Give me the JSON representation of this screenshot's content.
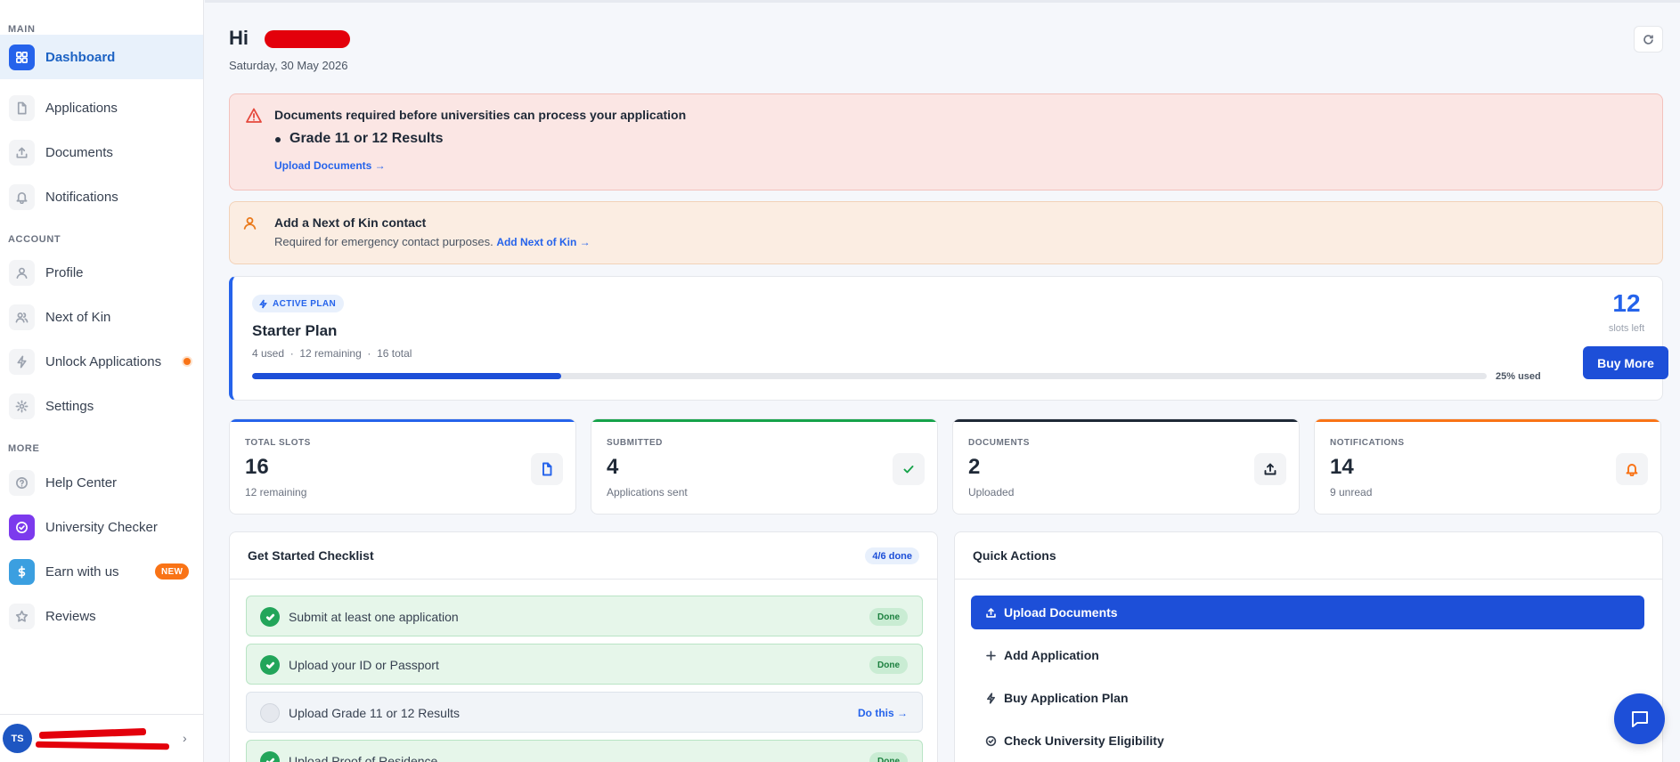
{
  "sidebar": {
    "sections": {
      "main": "MAIN",
      "account": "ACCOUNT",
      "more": "MORE"
    },
    "items": [
      {
        "label": "Dashboard",
        "icon": "grid-icon",
        "active": true
      },
      {
        "label": "Applications",
        "icon": "file-icon"
      },
      {
        "label": "Documents",
        "icon": "upload-icon"
      },
      {
        "label": "Notifications",
        "icon": "bell-icon"
      },
      {
        "label": "Profile",
        "icon": "user-icon"
      },
      {
        "label": "Next of Kin",
        "icon": "users-icon"
      },
      {
        "label": "Unlock Applications",
        "icon": "bolt-icon",
        "indicator": "orange-dot"
      },
      {
        "label": "Settings",
        "icon": "gear-icon"
      },
      {
        "label": "Help Center",
        "icon": "help-circle-icon"
      },
      {
        "label": "University Checker",
        "icon": "check-circle-icon"
      },
      {
        "label": "Earn with us",
        "icon": "dollar-icon",
        "badge": "NEW"
      },
      {
        "label": "Reviews",
        "icon": "star-icon"
      }
    ],
    "user": {
      "initials": "TS"
    }
  },
  "header": {
    "greeting": "Hi",
    "date": "Saturday, 30 May 2026"
  },
  "alerts": {
    "documents": {
      "title": "Documents required before universities can process your application",
      "bullet": "Grade 11 or 12 Results",
      "link": "Upload Documents →"
    },
    "next_of_kin": {
      "title": "Add a Next of Kin contact",
      "text": "Required for emergency contact purposes.",
      "link": "Add Next of Kin →"
    }
  },
  "plan": {
    "badge": "ACTIVE PLAN",
    "name": "Starter Plan",
    "used": "4 used",
    "remaining": "12 remaining",
    "total": "16 total",
    "separator": "·",
    "progress_percent": 25,
    "used_label": "25% used",
    "slots_left": "12",
    "slots_left_label": "slots left",
    "buy_label": "Buy More"
  },
  "stats": [
    {
      "label": "TOTAL SLOTS",
      "value": "16",
      "sub": "12 remaining",
      "icon": "file-icon",
      "color": "#2563eb"
    },
    {
      "label": "SUBMITTED",
      "value": "4",
      "sub": "Applications sent",
      "icon": "check-icon",
      "color": "#16a34a"
    },
    {
      "label": "DOCUMENTS",
      "value": "2",
      "sub": "Uploaded",
      "icon": "upload-icon",
      "color": "#1f2937"
    },
    {
      "label": "NOTIFICATIONS",
      "value": "14",
      "sub": "9 unread",
      "icon": "bell-icon",
      "color": "#f97316"
    }
  ],
  "checklist": {
    "title": "Get Started Checklist",
    "progress": "4/6 done",
    "items": [
      {
        "label": "Submit at least one application",
        "status": "Done",
        "done": true
      },
      {
        "label": "Upload your ID or Passport",
        "status": "Done",
        "done": true
      },
      {
        "label": "Upload Grade 11 or 12 Results",
        "status": "Do this →",
        "done": false
      },
      {
        "label": "Upload Proof of Residence",
        "status": "Done",
        "done": true
      }
    ]
  },
  "quick_actions": {
    "title": "Quick Actions",
    "items": [
      {
        "label": "Upload Documents",
        "icon": "upload-icon",
        "primary": true
      },
      {
        "label": "Add Application",
        "icon": "plus-icon"
      },
      {
        "label": "Buy Application Plan",
        "icon": "bolt-icon"
      },
      {
        "label": "Check University Eligibility",
        "icon": "check-circle-icon"
      }
    ]
  }
}
